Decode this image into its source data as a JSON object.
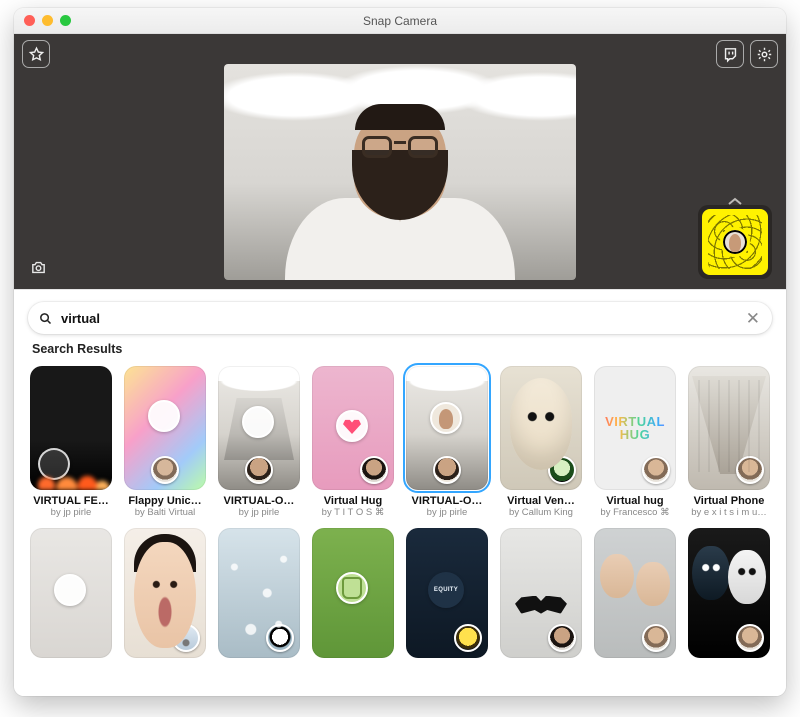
{
  "window": {
    "title": "Snap Camera"
  },
  "search": {
    "value": "virtual",
    "section_label": "Search Results"
  },
  "lenses_row1": [
    {
      "name": "VIRTUAL FE…",
      "author": "by jp pirle",
      "thumb": "t-fire",
      "avatar": "",
      "selected": false,
      "icon_pos": ""
    },
    {
      "name": "Flappy Unic…",
      "author": "by Balti Virtual",
      "thumb": "t-blur",
      "avatar": "av-generic",
      "selected": false,
      "icon_pos": "center"
    },
    {
      "name": "VIRTUAL-O…",
      "author": "by jp pirle",
      "thumb": "t-office perspective",
      "avatar": "av-beard",
      "selected": false,
      "icon_pos": "center"
    },
    {
      "name": "Virtual Hug",
      "author": "by T I T O S  ⌘",
      "thumb": "t-pink",
      "avatar": "av-dark",
      "selected": false,
      "icon_pos": ""
    },
    {
      "name": "VIRTUAL-O…",
      "author": "by jp pirle",
      "thumb": "t-office sel",
      "avatar": "av-beard",
      "selected": true,
      "icon_pos": "center"
    },
    {
      "name": "Virtual Ven…",
      "author": "by Callum King",
      "thumb": "t-mask",
      "avatar": "av-anon",
      "selected": false,
      "icon_pos": ""
    },
    {
      "name": "Virtual hug",
      "author": "by Francesco  ⌘",
      "thumb": "t-hugtext",
      "avatar": "av-generic",
      "selected": false,
      "icon_pos": ""
    },
    {
      "name": "Virtual Phone",
      "author": "by e x i t s i m u…",
      "thumb": "t-hall",
      "avatar": "av-generic",
      "selected": false,
      "icon_pos": ""
    }
  ],
  "lenses_row2": [
    {
      "thumb": "t-plain",
      "avatar": ""
    },
    {
      "thumb": "t-face hairblack",
      "avatar": "av-eiffel"
    },
    {
      "thumb": "t-snow",
      "avatar": "av-panda"
    },
    {
      "thumb": "t-green",
      "avatar": ""
    },
    {
      "thumb": "t-navy",
      "avatar": "av-yellow"
    },
    {
      "thumb": "t-stache",
      "avatar": "av-dark"
    },
    {
      "thumb": "t-duo",
      "avatar": "av-generic"
    },
    {
      "thumb": "t-bw",
      "avatar": "av-generic"
    }
  ]
}
